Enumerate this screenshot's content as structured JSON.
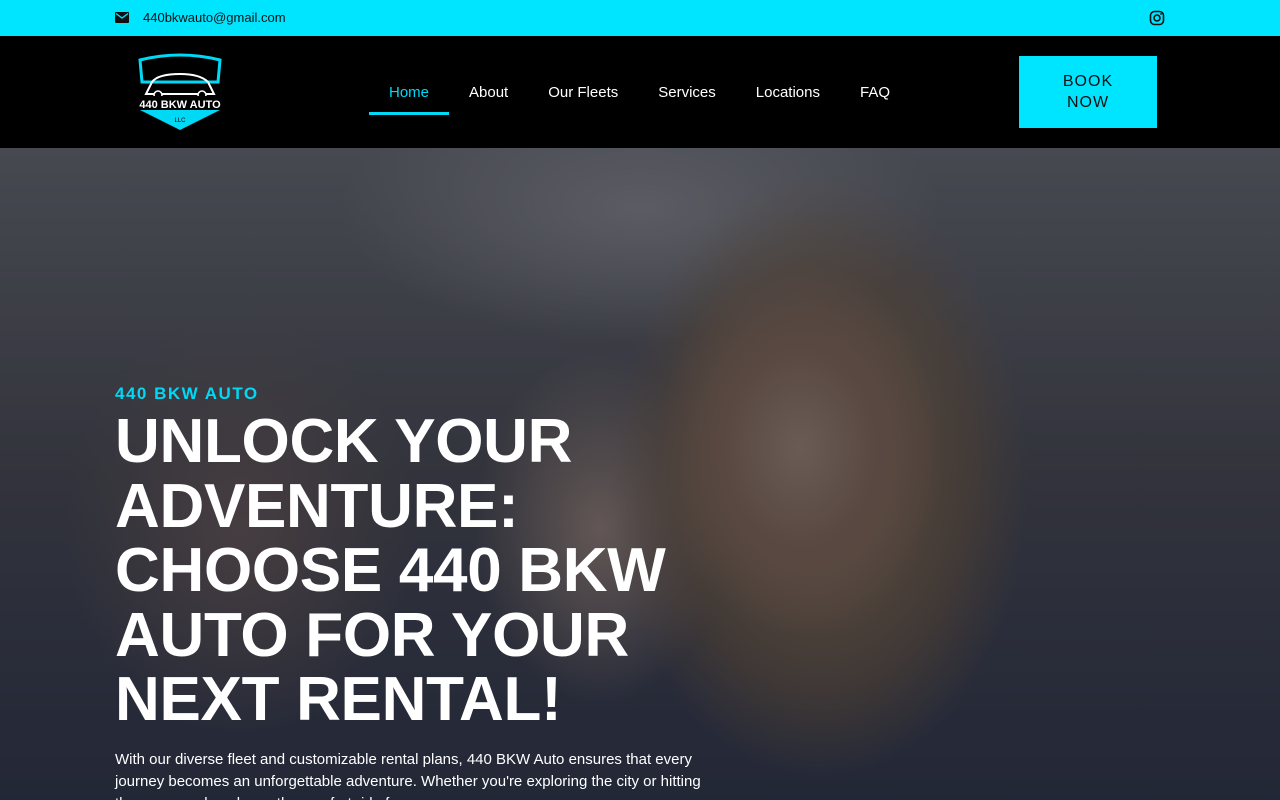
{
  "topbar": {
    "email": "440bkwauto@gmail.com",
    "mail_icon": "mail-icon",
    "social_icon": "instagram-icon",
    "bg_color": "#00e5ff"
  },
  "header": {
    "logo_text": "440 BKW AUTO",
    "logo_subtext": "LLC",
    "nav": [
      {
        "label": "Home",
        "active": true
      },
      {
        "label": "About",
        "active": false
      },
      {
        "label": "Our Fleets",
        "active": false
      },
      {
        "label": "Services",
        "active": false
      },
      {
        "label": "Locations",
        "active": false
      },
      {
        "label": "FAQ",
        "active": false
      }
    ],
    "cta_label": "BOOK NOW",
    "accent_color": "#00d9f5"
  },
  "hero": {
    "eyebrow": "440 BKW AUTO",
    "headline": "UNLOCK YOUR ADVENTURE: CHOOSE 440 BKW AUTO FOR YOUR NEXT RENTAL!",
    "subtext": "With our diverse fleet and customizable rental plans, 440 BKW Auto ensures that every journey becomes an unforgettable adventure. Whether you're exploring the city or hitting the open road, make us the comfort ride for you."
  }
}
